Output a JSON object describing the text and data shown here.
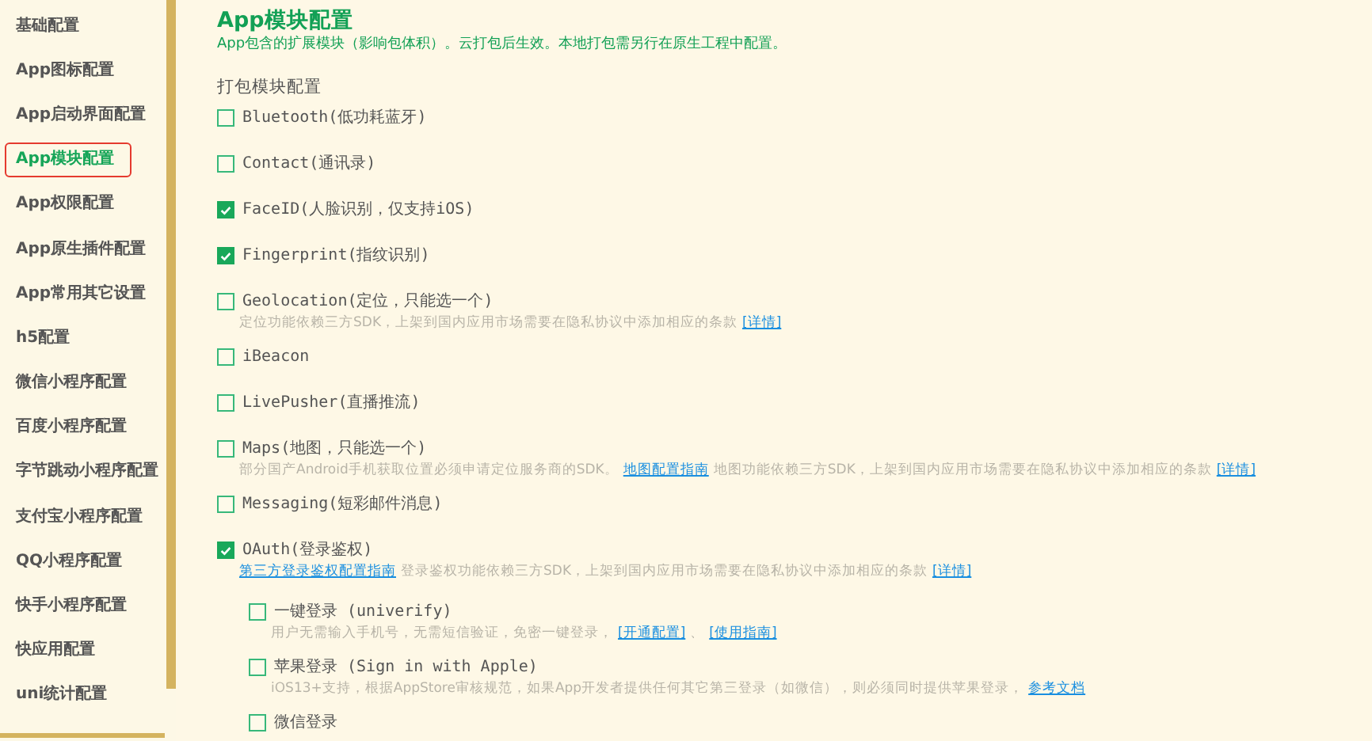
{
  "sidebar": {
    "items": [
      {
        "label": "基础配置",
        "selected": false
      },
      {
        "label": "App图标配置",
        "selected": false
      },
      {
        "label": "App启动界面配置",
        "selected": false
      },
      {
        "label": "App模块配置",
        "selected": true
      },
      {
        "label": "App权限配置",
        "selected": false
      },
      {
        "label": "App原生插件配置",
        "selected": false
      },
      {
        "label": "App常用其它设置",
        "selected": false
      },
      {
        "label": "h5配置",
        "selected": false
      },
      {
        "label": "微信小程序配置",
        "selected": false
      },
      {
        "label": "百度小程序配置",
        "selected": false
      },
      {
        "label": "字节跳动小程序配置",
        "selected": false
      },
      {
        "label": "支付宝小程序配置",
        "selected": false
      },
      {
        "label": "QQ小程序配置",
        "selected": false
      },
      {
        "label": "快手小程序配置",
        "selected": false
      },
      {
        "label": "快应用配置",
        "selected": false
      },
      {
        "label": "uni统计配置",
        "selected": false
      }
    ]
  },
  "main": {
    "title": "App模块配置",
    "subtitle": "App包含的扩展模块（影响包体积）。云打包后生效。本地打包需另行在原生工程中配置。",
    "section": "打包模块配置",
    "modules": [
      {
        "label": "Bluetooth(低功耗蓝牙)",
        "checked": false
      },
      {
        "label": "Contact(通讯录)",
        "checked": false
      },
      {
        "label": "FaceID(人脸识别，仅支持iOS)",
        "checked": true
      },
      {
        "label": "Fingerprint(指纹识别)",
        "checked": true
      },
      {
        "label": "Geolocation(定位，只能选一个)",
        "checked": false,
        "description": [
          {
            "kind": "text",
            "text": "定位功能依赖三方SDK，上架到国内应用市场需要在隐私协议中添加相应的条款"
          },
          {
            "kind": "link",
            "text": "[详情]"
          }
        ]
      },
      {
        "label": "iBeacon",
        "checked": false
      },
      {
        "label": "LivePusher(直播推流)",
        "checked": false
      },
      {
        "label": "Maps(地图，只能选一个)",
        "checked": false,
        "description": [
          {
            "kind": "text",
            "text": "部分国产Android手机获取位置必须申请定位服务商的SDK。"
          },
          {
            "kind": "link",
            "text": "地图配置指南"
          },
          {
            "kind": "text",
            "text": "地图功能依赖三方SDK，上架到国内应用市场需要在隐私协议中添加相应的条款"
          },
          {
            "kind": "link",
            "text": "[详情]"
          }
        ]
      },
      {
        "label": "Messaging(短彩邮件消息)",
        "checked": false
      },
      {
        "label": "OAuth(登录鉴权)",
        "checked": true,
        "description": [
          {
            "kind": "link",
            "text": "第三方登录鉴权配置指南"
          },
          {
            "kind": "text",
            "text": "登录鉴权功能依赖三方SDK，上架到国内应用市场需要在隐私协议中添加相应的条款"
          },
          {
            "kind": "link",
            "text": "[详情]"
          }
        ],
        "children": [
          {
            "label": "一键登录 (univerify)",
            "checked": false,
            "description": [
              {
                "kind": "text",
                "text": "用户无需输入手机号，无需短信验证，免密一键登录，"
              },
              {
                "kind": "link",
                "text": "[开通配置]"
              },
              {
                "kind": "text",
                "text": "、"
              },
              {
                "kind": "link",
                "text": "[使用指南]"
              }
            ]
          },
          {
            "label": "苹果登录 (Sign in with Apple)",
            "checked": false,
            "description": [
              {
                "kind": "text",
                "text": "iOS13+支持，根据AppStore审核规范，如果App开发者提供任何其它第三登录（如微信），则必须同时提供苹果登录，"
              },
              {
                "kind": "link",
                "text": "参考文档"
              }
            ]
          },
          {
            "label": "微信登录",
            "checked": false
          }
        ]
      }
    ]
  }
}
